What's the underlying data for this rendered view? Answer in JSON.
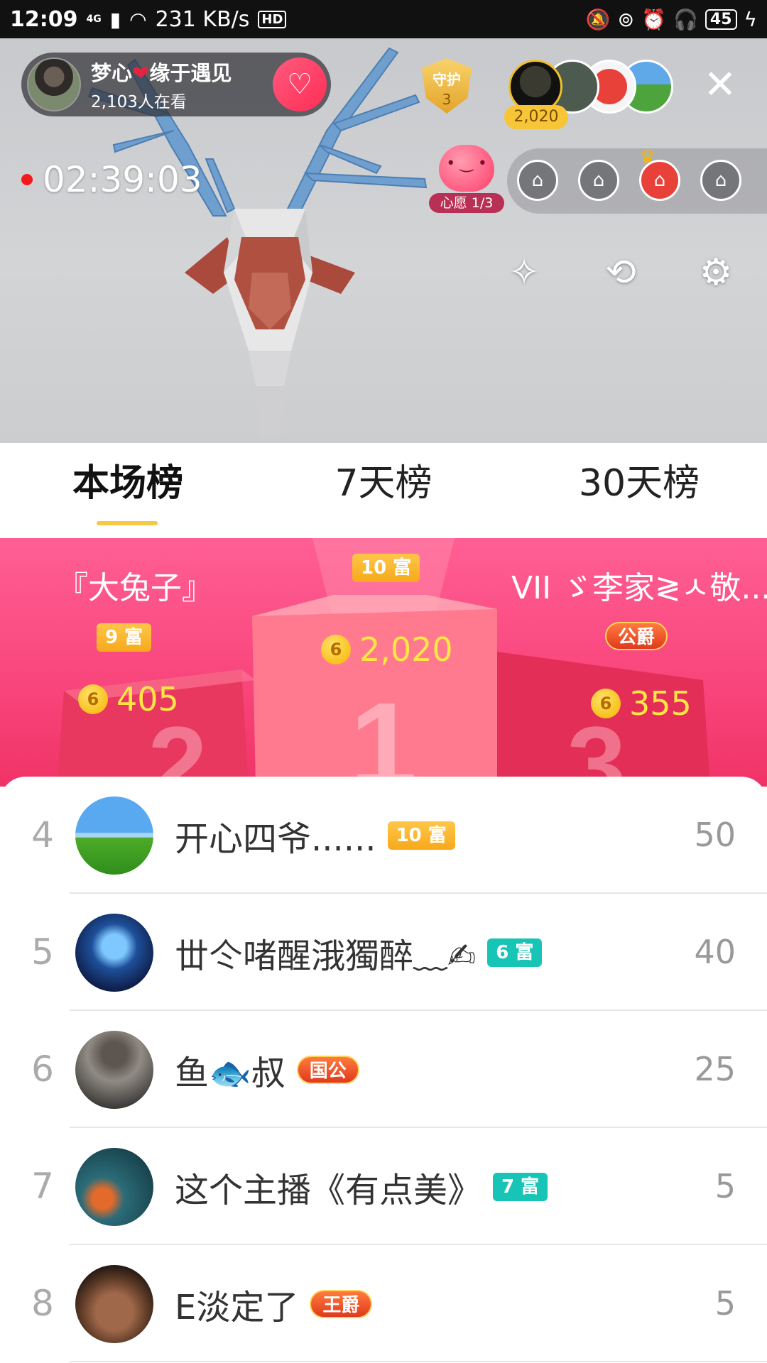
{
  "status_bar": {
    "time": "12:09",
    "network": "4G",
    "speed": "231 KB/s",
    "hd": "HD",
    "battery": "45"
  },
  "live": {
    "anchor_name": "梦心",
    "anchor_name_tail": "缘于遇见",
    "viewers": "2,103人在看",
    "guard_label": "守护",
    "guard_count": "3",
    "top_gift_count": "2,020",
    "timer": "02:39:03",
    "wish_label": "心愿 1/3",
    "icons": [
      "magic-wand-icon",
      "camera-flip-icon",
      "gear-icon"
    ]
  },
  "tabs": [
    "本场榜",
    "7天榜",
    "30天榜"
  ],
  "active_tab": "本场榜",
  "podium": {
    "first": {
      "badge": "10 富",
      "score": "2,020"
    },
    "second": {
      "name": "『大兔子』",
      "badge": "9 富",
      "score": "405"
    },
    "third": {
      "name": "VII ゞ李家≷ㅅ敬...",
      "badge": "公爵",
      "score": "355"
    },
    "coin_symbol": "6"
  },
  "ranking": [
    {
      "rank": "4",
      "name": "开心四爷......",
      "badge": "10 富",
      "badge_style": "gold",
      "score": "50"
    },
    {
      "rank": "5",
      "name": "丗仒啫醒涐獨醉﹏✍",
      "badge": "6 富",
      "badge_style": "teal",
      "score": "40"
    },
    {
      "rank": "6",
      "name": "鱼🐟叔",
      "badge": "国公",
      "badge_style": "noble",
      "score": "25"
    },
    {
      "rank": "7",
      "name": "这个主播《有点美》",
      "badge": "7 富",
      "badge_style": "teal",
      "score": "5"
    },
    {
      "rank": "8",
      "name": "E淡定了",
      "badge": "王爵",
      "badge_style": "noble",
      "score": "5"
    }
  ],
  "colors": {
    "accent_pink": "#f9477d",
    "tab_underline": "#f7c844",
    "wealth_gold": "#f7a91a",
    "wealth_teal": "#18c4b5",
    "coin_yellow": "#ffe545"
  }
}
